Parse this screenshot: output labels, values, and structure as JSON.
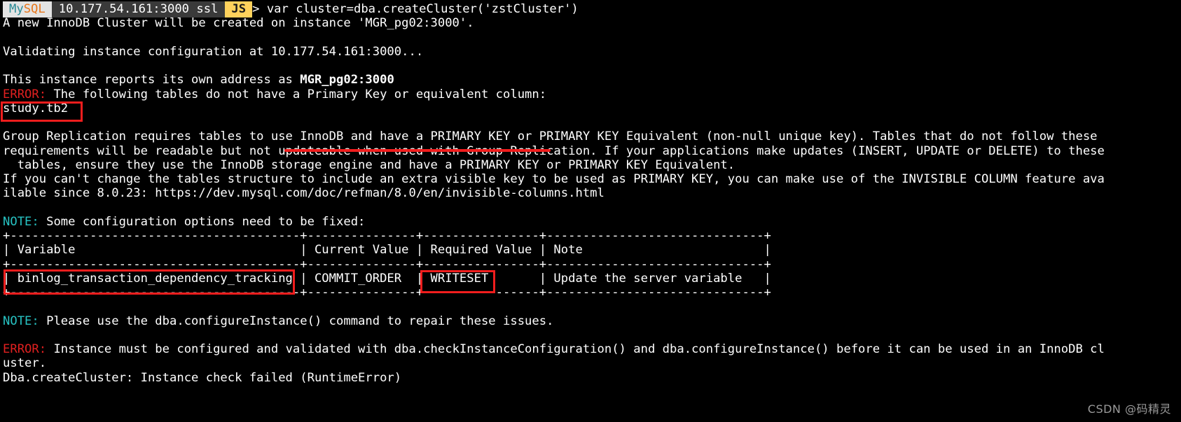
{
  "terminal": {
    "prompt": {
      "badge_mysql_my": "My",
      "badge_mysql_sql": "SQL",
      "badge_host": "10.177.54.161:3000 ssl",
      "badge_mode": "JS",
      "arrow": "> ",
      "command": "var cluster=dba.createCluster('zstCluster')"
    },
    "lines": [
      {
        "id": "l1",
        "text": "A new InnoDB Cluster will be created on instance 'MGR_pg02:3000'."
      },
      {
        "id": "l2",
        "text": ""
      },
      {
        "id": "l3",
        "text": "Validating instance configuration at 10.177.54.161:3000..."
      },
      {
        "id": "l4",
        "text": ""
      },
      {
        "id": "l5a",
        "text": "This instance reports its own address as "
      },
      {
        "id": "l5b",
        "text": "MGR_pg02:3000"
      },
      {
        "id": "l6a",
        "text": "ERROR: "
      },
      {
        "id": "l6b",
        "text": "The following tables do not have a Primary Key or equivalent column:"
      },
      {
        "id": "l7",
        "text": "study.tb2"
      },
      {
        "id": "l8",
        "text": ""
      },
      {
        "id": "l9",
        "text": "Group Replication requires tables to use InnoDB and have a PRIMARY KEY or PRIMARY KEY Equivalent (non-null unique key). Tables that do not follow these"
      },
      {
        "id": "l10",
        "text": "requirements will be readable but not updateable when used with Group Replication. If your applications make updates (INSERT, UPDATE or DELETE) to these"
      },
      {
        "id": "l11",
        "text": "  tables, ensure they use the InnoDB storage engine and have a PRIMARY KEY or PRIMARY KEY Equivalent."
      },
      {
        "id": "l12",
        "text": "If you can't change the tables structure to include an extra visible key to be used as PRIMARY KEY, you can make use of the INVISIBLE COLUMN feature ava"
      },
      {
        "id": "l13",
        "text": "ilable since 8.0.23: https://dev.mysql.com/doc/refman/8.0/en/invisible-columns.html"
      },
      {
        "id": "l14",
        "text": ""
      },
      {
        "id": "l15a",
        "text": "NOTE: "
      },
      {
        "id": "l15b",
        "text": "Some configuration options need to be fixed:"
      },
      {
        "id": "l16",
        "text": "+----------------------------------------+---------------+----------------+------------------------------+"
      },
      {
        "id": "l17",
        "text": "| Variable                               | Current Value | Required Value | Note                         |"
      },
      {
        "id": "l18",
        "text": "+----------------------------------------+---------------+----------------+------------------------------+"
      },
      {
        "id": "l19",
        "text": "| binlog_transaction_dependency_tracking | COMMIT_ORDER  | WRITESET       | Update the server variable   |"
      },
      {
        "id": "l20",
        "text": "+----------------------------------------+---------------+----------------+------------------------------+"
      },
      {
        "id": "l21",
        "text": ""
      },
      {
        "id": "l22a",
        "text": "NOTE: "
      },
      {
        "id": "l22b",
        "text": "Please use the dba.configureInstance() command to repair these issues."
      },
      {
        "id": "l23",
        "text": ""
      },
      {
        "id": "l24a",
        "text": "ERROR: "
      },
      {
        "id": "l24b",
        "text": "Instance must be configured and validated with dba.checkInstanceConfiguration() and dba.configureInstance() before it can be used in an InnoDB cl"
      },
      {
        "id": "l25",
        "text": "uster."
      },
      {
        "id": "l26",
        "text": "Dba.createCluster: Instance check failed (RuntimeError)"
      }
    ],
    "annotations": {
      "box_study_tb2_label": "study.tb2",
      "underline_primary_key_label": "use InnoDB and have a PRIMARY KEY",
      "box_variable_label": "binlog_transaction_dependency_tracking",
      "box_writeset_label": "WRITESET"
    },
    "watermark": "CSDN @码精灵",
    "colors": {
      "background": "#000000",
      "foreground": "#e8e8e8",
      "error": "#e02020",
      "note": "#27c3c3",
      "annotation": "#f01d1d",
      "badge_mysql_bg": "#e3e3e3",
      "badge_mysql_my": "#2a8a95",
      "badge_mysql_sql": "#e8761a",
      "badge_host_bg": "#3a3a3a",
      "badge_js_bg": "#ffd25c"
    }
  }
}
